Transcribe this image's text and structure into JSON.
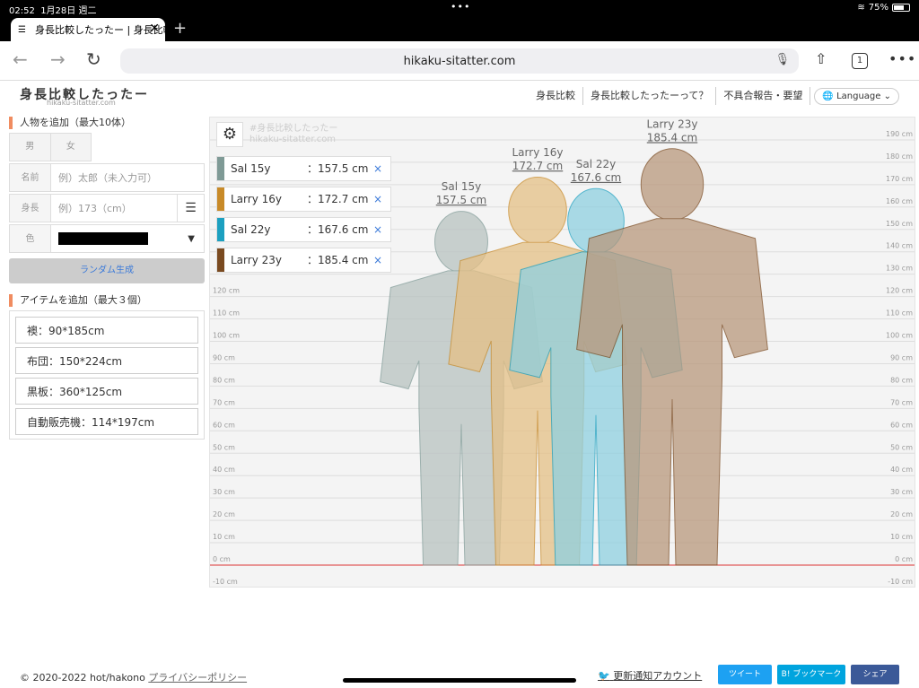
{
  "status": {
    "time": "02:52",
    "date": "1月28日 週二",
    "battery": "75%"
  },
  "tab": {
    "title": "身長比較したったー | 身長比較",
    "favicon": "☰"
  },
  "browser": {
    "url": "hikaku-sitatter.com",
    "tab_count": "1"
  },
  "site": {
    "logo": "身長比較したったー",
    "logo_sub": "hikaku-sitatter.com",
    "nav": [
      "身長比較",
      "身長比較したったーって？",
      "不具合報告・要望"
    ],
    "language": "Language"
  },
  "form": {
    "add_person": "人物を追加（最大10体）",
    "male": "男",
    "female": "女",
    "name_label": "名前",
    "name_placeholder": "例）太郎（未入力可）",
    "height_label": "身長",
    "height_placeholder": "例）173（cm）",
    "color_label": "色",
    "color_value": "#000000",
    "random": "ランダム生成",
    "add_item": "アイテムを追加（最大３個）",
    "items": [
      "襖：90*185cm",
      "布団：150*224cm",
      "黒板：360*125cm",
      "自動販売機：114*197cm"
    ]
  },
  "chart": {
    "watermark": "#身長比較したったー",
    "watermark_sub": "hikaku-sitatter.com",
    "ticks": [
      "190 cm",
      "180 cm",
      "170 cm",
      "160 cm",
      "150 cm",
      "140 cm",
      "130 cm",
      "120 cm",
      "110 cm",
      "100 cm",
      "90 cm",
      "80 cm",
      "70 cm",
      "60 cm",
      "50 cm",
      "40 cm",
      "30 cm",
      "20 cm",
      "10 cm",
      "0 cm",
      "-10 cm"
    ],
    "people": [
      {
        "name": "Sal 15y",
        "height": "157.5 cm",
        "h": 157.5,
        "color": "#7f9a96",
        "fill": "#b9c3c1"
      },
      {
        "name": "Larry 16y",
        "height": "172.7 cm",
        "h": 172.7,
        "color": "#c88a28",
        "fill": "#e5c086"
      },
      {
        "name": "Sal 22y",
        "height": "167.6 cm",
        "h": 167.6,
        "color": "#1ca0c0",
        "fill": "#8fd0e0"
      },
      {
        "name": "Larry 23y",
        "height": "185.4 cm",
        "h": 185.4,
        "color": "#7a4a20",
        "fill": "#b9987c"
      }
    ],
    "remove": "×"
  },
  "chart_data": {
    "type": "bar",
    "categories": [
      "Sal 15y",
      "Larry 16y",
      "Sal 22y",
      "Larry 23y"
    ],
    "values": [
      157.5,
      172.7,
      167.6,
      185.4
    ],
    "ylabel": "cm",
    "ylim": [
      -10,
      190
    ]
  },
  "footer": {
    "copyright": "© 2020-2022 hot/hakono",
    "privacy": "プライバシーポリシー",
    "update": "更新通知アカウント",
    "tweet": "ツイート",
    "bookmark": "B! ブックマーク",
    "share": "シェア"
  }
}
